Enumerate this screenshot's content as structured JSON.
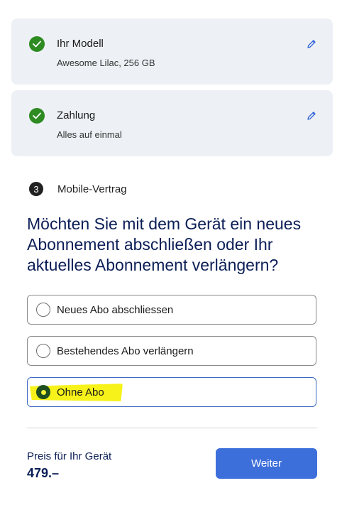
{
  "summary": {
    "model": {
      "title": "Ihr Modell",
      "value": "Awesome Lilac, 256 GB"
    },
    "payment": {
      "title": "Zahlung",
      "value": "Alles auf einmal"
    }
  },
  "step": {
    "number": "3",
    "label": "Mobile-Vertrag"
  },
  "question": "Möchten Sie mit dem Gerät ein neues Abonnement abschließen oder Ihr aktuelles Abonnement verlängern?",
  "options": [
    {
      "label": "Neues Abo abschliessen",
      "selected": false
    },
    {
      "label": "Bestehendes Abo verlängern",
      "selected": false
    },
    {
      "label": "Ohne Abo",
      "selected": true
    }
  ],
  "footer": {
    "price_label": "Preis für Ihr Gerät",
    "price_value": "479.–",
    "cta_label": "Weiter"
  },
  "colors": {
    "card_bg": "#edf1f5",
    "check_green": "#2e8b22",
    "heading_navy": "#0b1e57",
    "selected_border": "#3b68c4",
    "highlight_yellow": "#f7f21a",
    "cta_blue": "#3d6fdb"
  },
  "icons": {
    "done": "check-circle-icon",
    "edit": "pencil-icon"
  }
}
